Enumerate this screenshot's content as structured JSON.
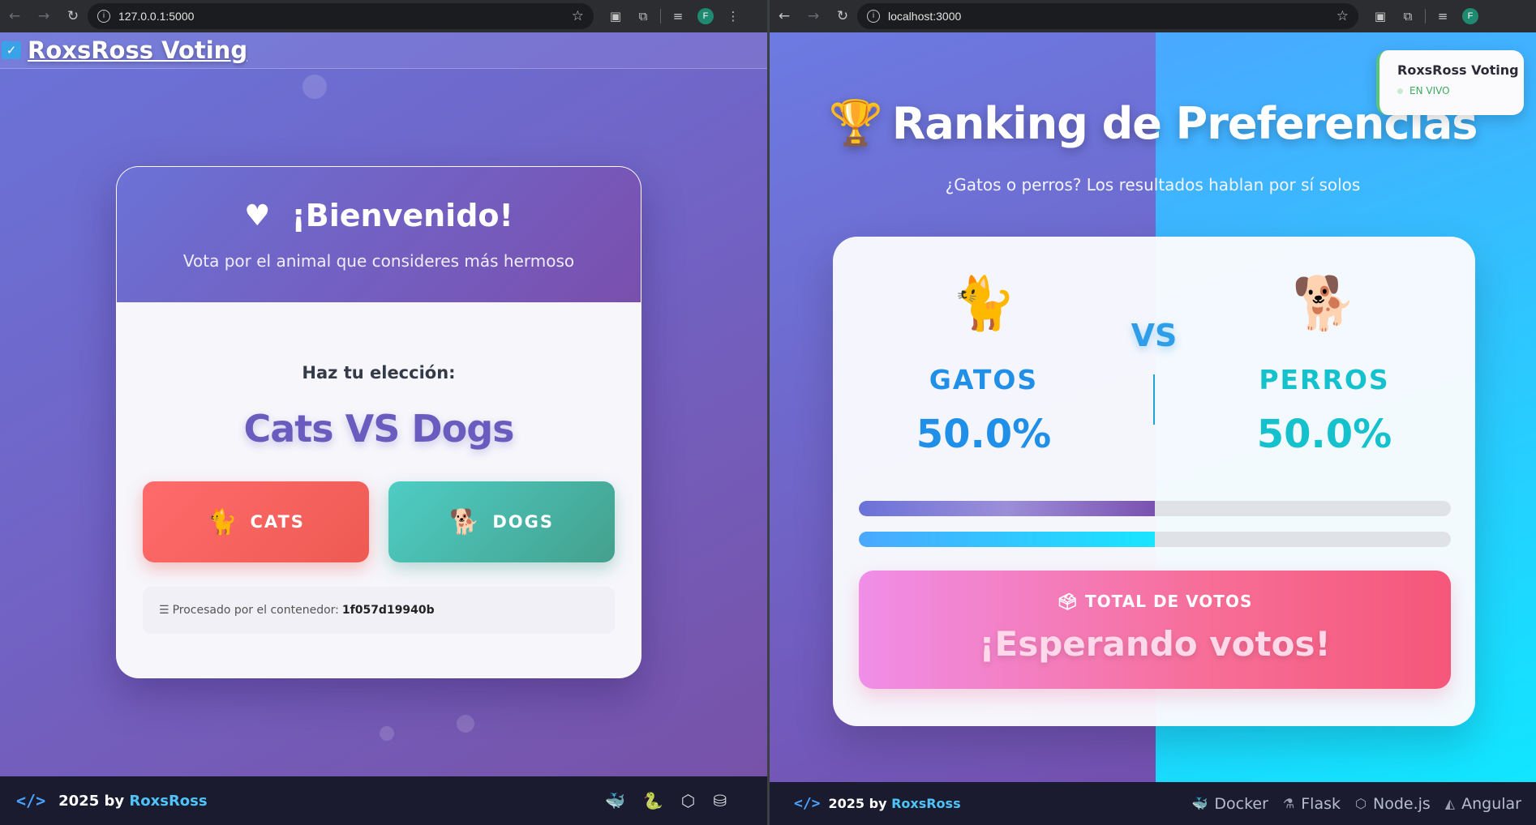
{
  "left_browser": {
    "url": "127.0.0.1:5000",
    "profile_initial": "F"
  },
  "right_browser": {
    "url": "localhost:3000",
    "profile_initial": "F"
  },
  "voting_app": {
    "brand": "RoxsRoss Voting",
    "welcome_title": "¡Bienvenido!",
    "welcome_subtitle": "Vota por el animal que consideres más hermoso",
    "choose_label": "Haz tu elección:",
    "matchup_title": "Cats VS Dogs",
    "option_a_label": "CATS",
    "option_b_label": "DOGS",
    "processed_label": "Procesado por el contenedor:",
    "container_id": "1f057d19940b",
    "footer_year_by": "2025 by",
    "footer_author": "RoxsRoss",
    "tech_icons": [
      "docker-icon",
      "python-icon",
      "nodejs-icon",
      "database-icon"
    ]
  },
  "results_app": {
    "badge_title": "RoxsRoss Voting",
    "badge_status": "EN VIVO",
    "title": "Ranking de Preferencias",
    "subtitle": "¿Gatos o perros? Los resultados hablan por sí solos",
    "vs_label": "VS",
    "cats_label": "GATOS",
    "cats_percent": "50.0%",
    "cats_share": 0.5,
    "dogs_label": "PERROS",
    "dogs_percent": "50.0%",
    "dogs_share": 0.5,
    "total_label": "TOTAL DE VOTOS",
    "total_value": "¡Esperando votos!",
    "footer_year_by": "2025 by",
    "footer_author": "RoxsRoss",
    "tech_stack": [
      "Docker",
      "Flask",
      "Node.js",
      "Angular"
    ]
  },
  "colors": {
    "cats_button": "#ee5a52",
    "dogs_button": "#44a08d",
    "accent_blue": "#1f8fe8",
    "accent_teal": "#14c1cc",
    "total_box": "#f76d96",
    "footer_bg": "#1a1b2e"
  }
}
